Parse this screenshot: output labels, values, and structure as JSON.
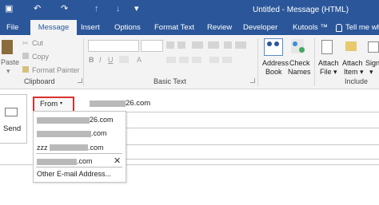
{
  "title_bar": {
    "title": "Untitled - Message (HTML)",
    "save_glyph": "▣",
    "undo_glyph": "↶",
    "redo_glyph": "↷",
    "up_glyph": "↑",
    "down_glyph": "↓",
    "more_glyph": "▾"
  },
  "tabs": [
    {
      "label": "File"
    },
    {
      "label": "Message"
    },
    {
      "label": "Insert"
    },
    {
      "label": "Options"
    },
    {
      "label": "Format Text"
    },
    {
      "label": "Review"
    },
    {
      "label": "Developer"
    },
    {
      "label": "Kutools ™"
    },
    {
      "label": "Tell me wh"
    }
  ],
  "tell_me_icon": "lightbulb-icon",
  "clipboard": {
    "paste": "Paste",
    "paste_caret": "▾",
    "cut": "Cut",
    "copy": "Copy",
    "format_painter": "Format Painter",
    "label": "Clipboard"
  },
  "basic_text": {
    "label": "Basic Text",
    "bold": "B",
    "italic": "I",
    "underline": "U",
    "font_color": "A"
  },
  "names": {
    "address_book_1": "Address",
    "address_book_2": "Book",
    "check_names_1": "Check",
    "check_names_2": "Names"
  },
  "include": {
    "attach_file_1": "Attach",
    "attach_file_2": "File ▾",
    "attach_item_1": "Attach",
    "attach_item_2": "Item ▾",
    "signature_1": "Signa",
    "signature_2": "▾",
    "label": "Include"
  },
  "compose": {
    "send": "Send",
    "from": "From",
    "from_caret": "▾",
    "from_value_suffix": "26.com",
    "accounts": [
      {
        "suffix": "26.com"
      },
      {
        "suffix": ".com"
      },
      {
        "prefix": "zzz",
        "suffix": ".com"
      },
      {
        "suffix": ".com"
      }
    ],
    "remove_glyph": "✕",
    "other_address": "Other E-mail Address..."
  }
}
